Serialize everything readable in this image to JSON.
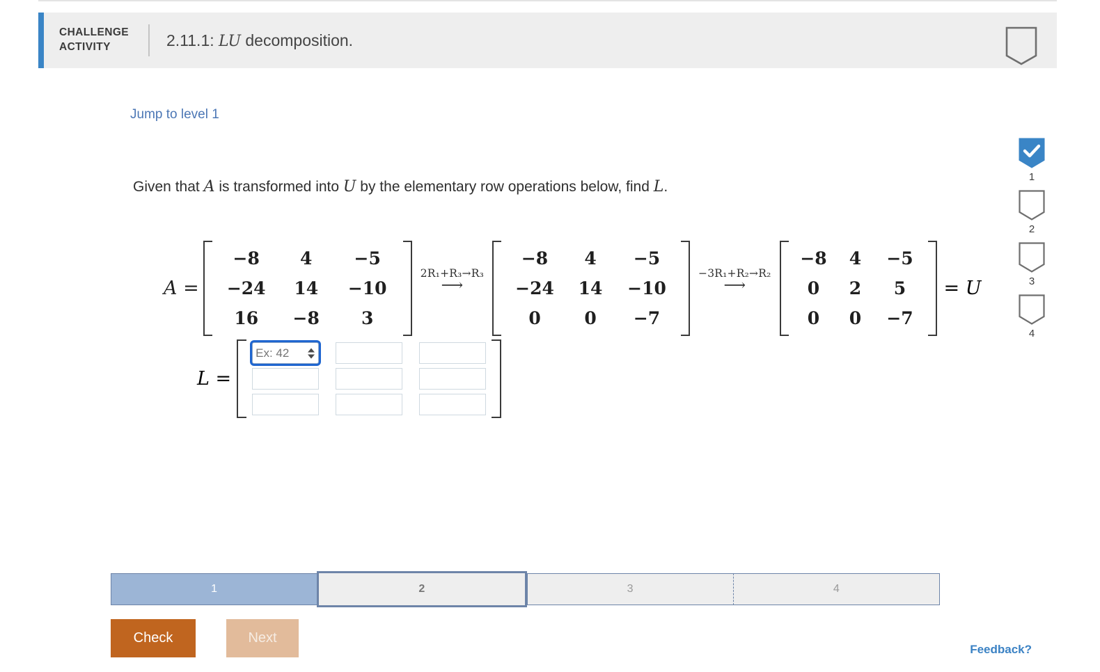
{
  "header": {
    "kicker_line1": "CHALLENGE",
    "kicker_line2": "ACTIVITY",
    "title_number": "2.11.1:",
    "title_math": "LU",
    "title_rest": "decomposition.",
    "accent_color": "#3a85c6",
    "background_color": "#eeeeee",
    "badge_icon": "shield-outline-icon"
  },
  "content": {
    "jump_link": "Jump to level 1",
    "prompt_part1": "Given that",
    "prompt_var_a": "A",
    "prompt_part2": "is transformed into",
    "prompt_var_u": "U",
    "prompt_part3": "by the elementary row operations below, find",
    "prompt_var_l": "L",
    "prompt_period": "."
  },
  "equation": {
    "a_label": "A =",
    "matrix_a": [
      [
        "−8",
        "4",
        "−5"
      ],
      [
        "−24",
        "14",
        "−10"
      ],
      [
        "16",
        "−8",
        "3"
      ]
    ],
    "op1_label": "2R₁+R₃→R₃",
    "op1_arrow": "⟶",
    "matrix_b": [
      [
        "−8",
        "4",
        "−5"
      ],
      [
        "−24",
        "14",
        "−10"
      ],
      [
        "0",
        "0",
        "−7"
      ]
    ],
    "op2_label": "−3R₁+R₂→R₂",
    "op2_arrow": "⟶",
    "matrix_u": [
      [
        "−8",
        "4",
        "−5"
      ],
      [
        "0",
        "2",
        "5"
      ],
      [
        "0",
        "0",
        "−7"
      ]
    ],
    "u_suffix_eq": "=",
    "u_suffix_var": "U"
  },
  "answer": {
    "l_label": "L =",
    "placeholder": "Ex: 42",
    "cells": [
      {
        "value": "",
        "focused": true
      },
      {
        "value": "",
        "focused": false
      },
      {
        "value": "",
        "focused": false
      },
      {
        "value": "",
        "focused": false
      },
      {
        "value": "",
        "focused": false
      },
      {
        "value": "",
        "focused": false
      },
      {
        "value": "",
        "focused": false
      },
      {
        "value": "",
        "focused": false
      },
      {
        "value": "",
        "focused": false
      }
    ],
    "spinner_icon": "spinner-up-down-icon"
  },
  "progress": {
    "segments": [
      {
        "label": "1",
        "state": "done"
      },
      {
        "label": "2",
        "state": "current"
      },
      {
        "label": "3",
        "state": "todo"
      },
      {
        "label": "4",
        "state": "todo"
      }
    ],
    "done_color": "#9cb5d6",
    "border_color": "#6d84a8"
  },
  "actions": {
    "check_label": "Check",
    "check_color": "#c0651f",
    "next_label": "Next",
    "next_color": "#e2bb9b",
    "feedback_label": "Feedback?",
    "feedback_color": "#3b82c4"
  },
  "rail": {
    "items": [
      {
        "number": "1",
        "state": "complete",
        "icon": "shield-check-icon"
      },
      {
        "number": "2",
        "state": "incomplete",
        "icon": "shield-outline-icon"
      },
      {
        "number": "3",
        "state": "incomplete",
        "icon": "shield-outline-icon"
      },
      {
        "number": "4",
        "state": "incomplete",
        "icon": "shield-outline-icon"
      }
    ],
    "complete_color": "#3a85c6"
  }
}
